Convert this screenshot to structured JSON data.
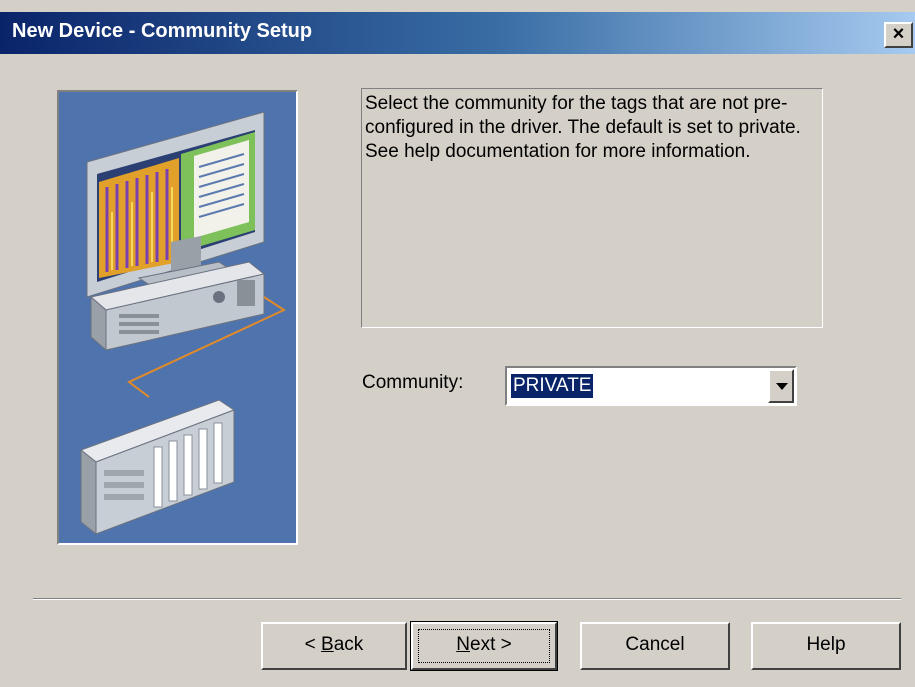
{
  "window": {
    "title": "New Device - Community Setup",
    "close_label": "×"
  },
  "description": "Select the community for the tags that are not pre-configured in the driver. The default is set to private. See help documentation for more information.",
  "community": {
    "label": "Community:",
    "value": "PRIVATE"
  },
  "buttons": {
    "back": {
      "prefix": "< ",
      "mnemonic": "B",
      "rest": "ack"
    },
    "next": {
      "mnemonic": "N",
      "rest": "ext >"
    },
    "cancel": "Cancel",
    "help": "Help"
  },
  "colors": {
    "dialog_bg": "#d4d0c8",
    "titlebar_start": "#0a246a",
    "titlebar_end": "#a6caf0",
    "illustration_bg": "#4f74ad",
    "selection": "#0a246a"
  },
  "icons": {
    "illustration": "computer-connected-to-plc"
  }
}
